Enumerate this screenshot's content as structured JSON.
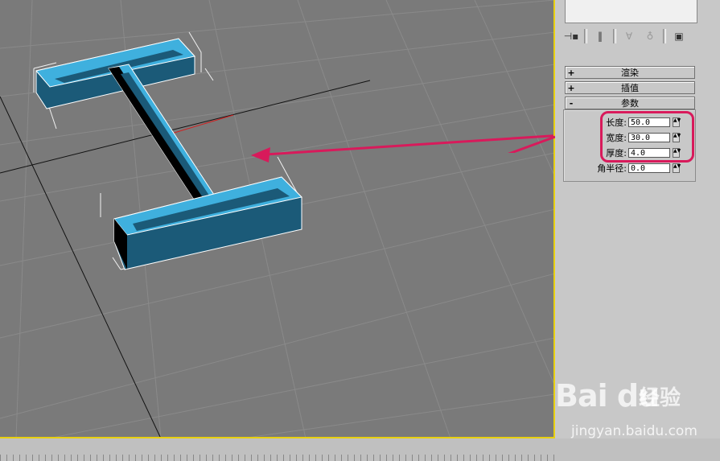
{
  "toolbar": {
    "icons": [
      "pin-icon",
      "modifier-stack-icon",
      "show-end-result-icon",
      "make-unique-icon",
      "remove-modifier-icon",
      "configure-modifier-sets-icon"
    ]
  },
  "rollouts": [
    {
      "sign": "+",
      "label": "渲染"
    },
    {
      "sign": "+",
      "label": "插值"
    },
    {
      "sign": "-",
      "label": "参数"
    }
  ],
  "params": {
    "length": {
      "label": "长度:",
      "value": "50.0"
    },
    "width": {
      "label": "宽度:",
      "value": "30.0"
    },
    "thickness": {
      "label": "厚度:",
      "value": "4.0"
    },
    "corner_radius": {
      "label": "角半径:",
      "value": "0.0"
    }
  },
  "spinner_glyph": "▲▼",
  "watermark": {
    "logo": "Bai du",
    "cn": "经验",
    "url": "jingyan.baidu.com"
  },
  "colors": {
    "shape_top": "#3fb0de",
    "shape_side": "#1b5a78",
    "highlight": "#d81a5b",
    "viewport_border": "#e8d010"
  }
}
